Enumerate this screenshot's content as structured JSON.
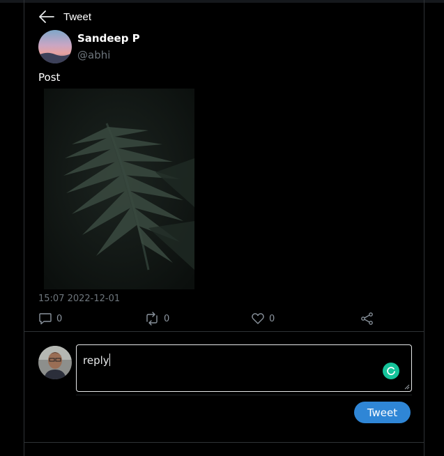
{
  "header": {
    "title": "Tweet",
    "back_icon": "arrow-left-icon"
  },
  "tweet": {
    "author_name": "Sandeep P",
    "author_handle": "@abhi",
    "text": "Post",
    "timestamp": "15:07 2022-12-01",
    "counts": {
      "reply": "0",
      "retweet": "0",
      "like": "0"
    }
  },
  "reply": {
    "value": "reply",
    "button_label": "Tweet"
  },
  "colors": {
    "accent": "#2f86d6",
    "border": "#2f3336",
    "muted": "#6e767d",
    "grammarly": "#15c39a"
  }
}
